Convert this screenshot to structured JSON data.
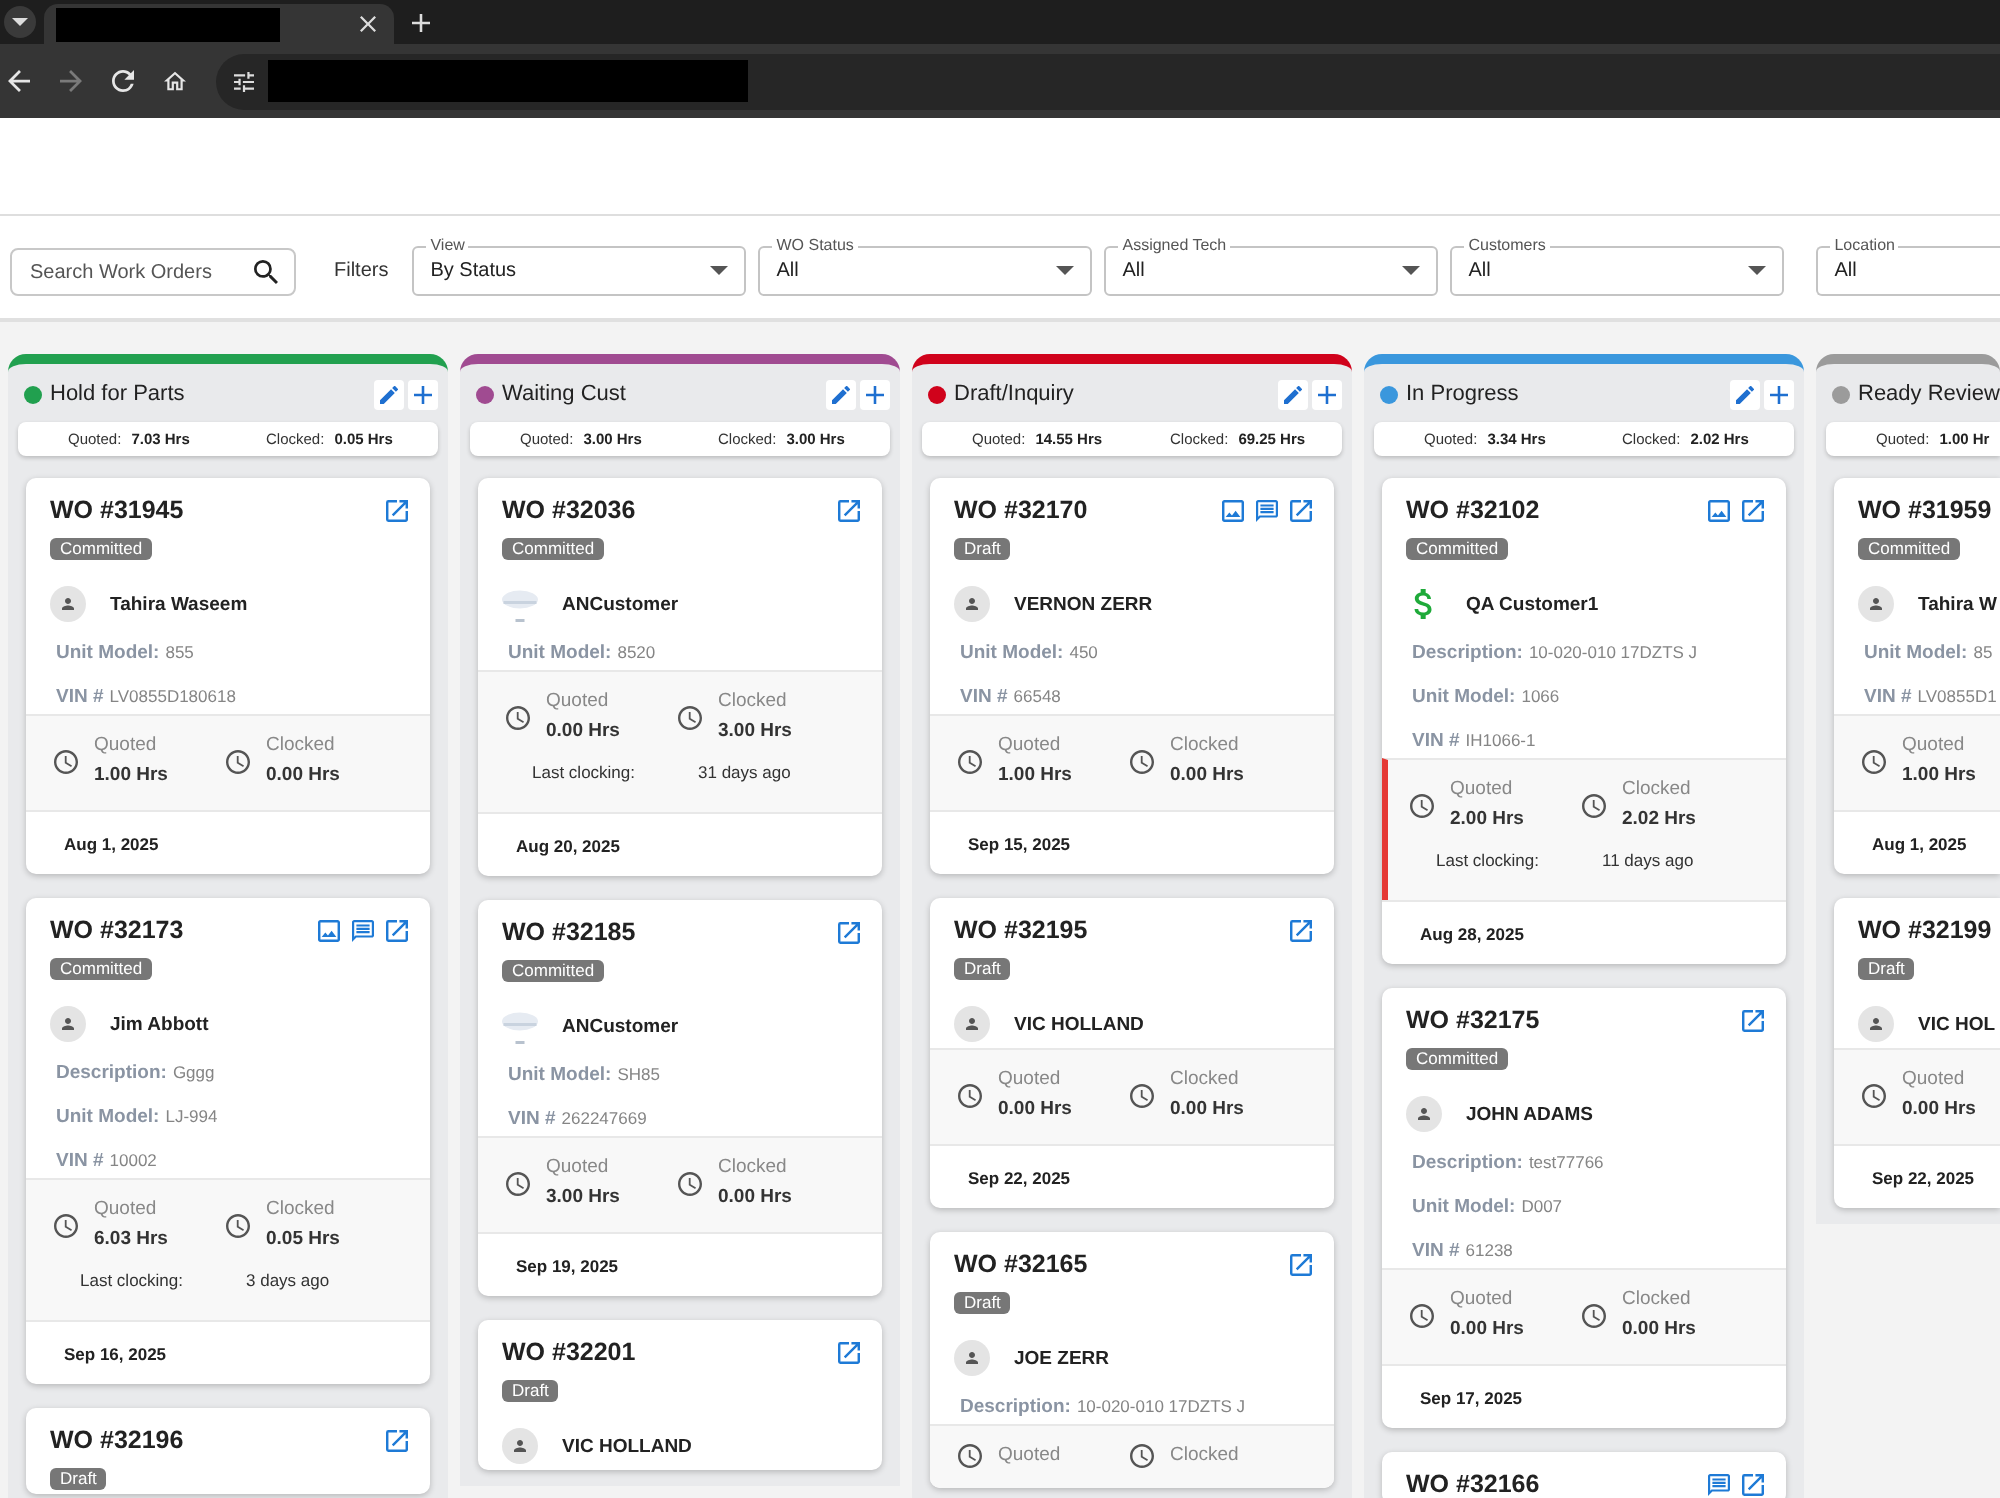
{
  "browser": {
    "nav_buttons": [
      {
        "kind": "back",
        "disabled": false
      },
      {
        "kind": "forward",
        "disabled": true
      },
      {
        "kind": "reload",
        "disabled": false
      },
      {
        "kind": "home",
        "disabled": false
      }
    ]
  },
  "filters": {
    "search": {
      "placeholder": "Search Work Orders"
    },
    "label": "Filters",
    "selects": [
      {
        "label": "View",
        "value": "By Status"
      },
      {
        "label": "WO Status",
        "value": "All"
      },
      {
        "label": "Assigned Tech",
        "value": "All"
      },
      {
        "label": "Customers",
        "value": "All"
      },
      {
        "label": "Location",
        "value": "All"
      }
    ]
  },
  "columns": [
    {
      "title": "Hold for Parts",
      "color": "#21a04f",
      "actions": [
        {
          "kind": "edit"
        },
        {
          "kind": "add"
        }
      ],
      "summary": {
        "quoted_label": "Quoted:",
        "quoted": "7.03 Hrs",
        "clocked_label": "Clocked:",
        "clocked": "0.05 Hrs"
      },
      "cards": [
        {
          "wo": "WO #31945",
          "status": "Committed",
          "icons": [
            {
              "kind": "open"
            }
          ],
          "customer": {
            "kind": "person",
            "name": "Tahira Waseem"
          },
          "details": [
            {
              "label": "Unit Model:",
              "value": "855"
            },
            {
              "label": "VIN #",
              "value": "LV0855D180618"
            }
          ],
          "hours": {
            "flagged": false,
            "quoted_label": "Quoted",
            "quoted": "1.00 Hrs",
            "clocked_label": "Clocked",
            "clocked": "0.00 Hrs"
          },
          "date": "Aug 1, 2025"
        },
        {
          "wo": "WO #32173",
          "status": "Committed",
          "icons": [
            {
              "kind": "photo"
            },
            {
              "kind": "notes"
            },
            {
              "kind": "open"
            }
          ],
          "customer": {
            "kind": "person",
            "name": "Jim Abbott"
          },
          "details": [
            {
              "label": "Description:",
              "value": "Gggg"
            },
            {
              "label": "Unit Model:",
              "value": "LJ-994"
            },
            {
              "label": "VIN #",
              "value": "10002"
            }
          ],
          "hours": {
            "flagged": false,
            "quoted_label": "Quoted",
            "quoted": "6.03 Hrs",
            "clocked_label": "Clocked",
            "clocked": "0.05 Hrs",
            "last_label": "Last clocking:",
            "last_value": "3 days ago"
          },
          "date": "Sep 16, 2025"
        },
        {
          "wo": "WO #32196",
          "status": "Draft",
          "icons": [
            {
              "kind": "open"
            }
          ]
        }
      ]
    },
    {
      "title": "Waiting Cust",
      "color": "#a04b91",
      "actions": [
        {
          "kind": "edit"
        },
        {
          "kind": "add"
        }
      ],
      "summary": {
        "quoted_label": "Quoted:",
        "quoted": "3.00 Hrs",
        "clocked_label": "Clocked:",
        "clocked": "3.00 Hrs"
      },
      "cards": [
        {
          "wo": "WO #32036",
          "status": "Committed",
          "icons": [
            {
              "kind": "open"
            }
          ],
          "customer": {
            "kind": "logo",
            "name": "ANCustomer"
          },
          "details": [
            {
              "label": "Unit Model:",
              "value": "8520"
            }
          ],
          "hours": {
            "flagged": false,
            "quoted_label": "Quoted",
            "quoted": "0.00 Hrs",
            "clocked_label": "Clocked",
            "clocked": "3.00 Hrs",
            "last_label": "Last clocking:",
            "last_value": "31 days ago"
          },
          "date": "Aug 20, 2025"
        },
        {
          "wo": "WO #32185",
          "status": "Committed",
          "icons": [
            {
              "kind": "open"
            }
          ],
          "customer": {
            "kind": "logo",
            "name": "ANCustomer"
          },
          "details": [
            {
              "label": "Unit Model:",
              "value": "SH85"
            },
            {
              "label": "VIN #",
              "value": "262247669"
            }
          ],
          "hours": {
            "flagged": false,
            "quoted_label": "Quoted",
            "quoted": "3.00 Hrs",
            "clocked_label": "Clocked",
            "clocked": "0.00 Hrs"
          },
          "date": "Sep 19, 2025"
        },
        {
          "wo": "WO #32201",
          "status": "Draft",
          "icons": [
            {
              "kind": "open"
            }
          ],
          "customer": {
            "kind": "person",
            "name": "VIC HOLLAND"
          }
        }
      ]
    },
    {
      "title": "Draft/Inquiry",
      "color": "#d0021b",
      "actions": [
        {
          "kind": "edit"
        },
        {
          "kind": "add"
        }
      ],
      "summary": {
        "quoted_label": "Quoted:",
        "quoted": "14.55 Hrs",
        "clocked_label": "Clocked:",
        "clocked": "69.25 Hrs"
      },
      "cards": [
        {
          "wo": "WO #32170",
          "status": "Draft",
          "icons": [
            {
              "kind": "photo"
            },
            {
              "kind": "notes"
            },
            {
              "kind": "open"
            }
          ],
          "customer": {
            "kind": "person",
            "name": "VERNON ZERR"
          },
          "details": [
            {
              "label": "Unit Model:",
              "value": "450"
            },
            {
              "label": "VIN #",
              "value": "66548"
            }
          ],
          "hours": {
            "flagged": false,
            "quoted_label": "Quoted",
            "quoted": "1.00 Hrs",
            "clocked_label": "Clocked",
            "clocked": "0.00 Hrs"
          },
          "date": "Sep 15, 2025"
        },
        {
          "wo": "WO #32195",
          "status": "Draft",
          "icons": [
            {
              "kind": "open"
            }
          ],
          "customer": {
            "kind": "person",
            "name": "VIC HOLLAND"
          },
          "hours": {
            "flagged": false,
            "quoted_label": "Quoted",
            "quoted": "0.00 Hrs",
            "clocked_label": "Clocked",
            "clocked": "0.00 Hrs"
          },
          "date": "Sep 22, 2025"
        },
        {
          "wo": "WO #32165",
          "status": "Draft",
          "icons": [
            {
              "kind": "open"
            }
          ],
          "customer": {
            "kind": "person",
            "name": "JOE ZERR"
          },
          "details": [
            {
              "label": "Description:",
              "value": "10-020-010 17DZTS J"
            }
          ],
          "hours": {
            "flagged": false,
            "quoted_label": "Quoted",
            "clocked_label": "Clocked"
          }
        }
      ]
    },
    {
      "title": "In Progress",
      "color": "#3a97dd",
      "actions": [
        {
          "kind": "edit"
        },
        {
          "kind": "add"
        }
      ],
      "summary": {
        "quoted_label": "Quoted:",
        "quoted": "3.34 Hrs",
        "clocked_label": "Clocked:",
        "clocked": "2.02 Hrs"
      },
      "cards": [
        {
          "wo": "WO #32102",
          "status": "Committed",
          "icons": [
            {
              "kind": "photo"
            },
            {
              "kind": "open"
            }
          ],
          "customer": {
            "kind": "dollar",
            "name": "QA Customer1"
          },
          "details": [
            {
              "label": "Description:",
              "value": "10-020-010 17DZTS J"
            },
            {
              "label": "Unit Model:",
              "value": "1066"
            },
            {
              "label": "VIN #",
              "value": "IH1066-1"
            }
          ],
          "hours": {
            "flagged": true,
            "quoted_label": "Quoted",
            "quoted": "2.00 Hrs",
            "clocked_label": "Clocked",
            "clocked": "2.02 Hrs",
            "last_label": "Last clocking:",
            "last_value": "11 days ago"
          },
          "date": "Aug 28, 2025"
        },
        {
          "wo": "WO #32175",
          "status": "Committed",
          "icons": [
            {
              "kind": "open"
            }
          ],
          "customer": {
            "kind": "person",
            "name": "JOHN ADAMS"
          },
          "details": [
            {
              "label": "Description:",
              "value": "test77766"
            },
            {
              "label": "Unit Model:",
              "value": "D007"
            },
            {
              "label": "VIN #",
              "value": "61238"
            }
          ],
          "hours": {
            "flagged": false,
            "quoted_label": "Quoted",
            "quoted": "0.00 Hrs",
            "clocked_label": "Clocked",
            "clocked": "0.00 Hrs"
          },
          "date": "Sep 17, 2025"
        },
        {
          "wo": "WO #32166",
          "icons": [
            {
              "kind": "notes"
            },
            {
              "kind": "open"
            }
          ]
        }
      ]
    },
    {
      "title": "Ready Review",
      "color": "#9b9b9b",
      "summary": {
        "quoted_label": "Quoted:",
        "quoted": "1.00 Hr"
      },
      "cards": [
        {
          "wo": "WO #31959",
          "status": "Committed",
          "customer": {
            "kind": "person",
            "name": "Tahira W"
          },
          "details": [
            {
              "label": "Unit Model:",
              "value": "85"
            },
            {
              "label": "VIN #",
              "value": "LV0855D1"
            }
          ],
          "hours": {
            "flagged": false,
            "quoted_label": "Quoted",
            "quoted": "1.00 Hrs"
          },
          "date": "Aug 1, 2025"
        },
        {
          "wo": "WO #32199",
          "status": "Draft",
          "customer": {
            "kind": "person",
            "name": "VIC HOL"
          },
          "hours": {
            "flagged": false,
            "quoted_label": "Quoted",
            "quoted": "0.00 Hrs"
          },
          "date": "Sep 22, 2025"
        }
      ]
    }
  ]
}
